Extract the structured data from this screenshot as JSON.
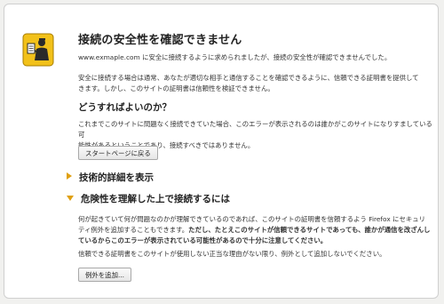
{
  "page": {
    "title": "接続の安全性を確認できません",
    "intro_host": "www.exmaple.com",
    "intro_rest": " に安全に接続するように求められましたが、接続の安全性が確認できませんでした。",
    "paragraph1_line1": "安全に接続する場合は通常、あなたが適切な相手と通信することを確認できるように、信頼できる証明書を提供して",
    "paragraph1_line2": "きます。しかし、このサイトの証明書は信頼性を検証できません。",
    "what_heading": "どうすればよいのか？",
    "paragraph2_line1": "これまでこのサイトに問題なく接続できていた場合、このエラーが表示されるのは誰かがこのサイトになりすましている可",
    "paragraph2_line2": "能性があるということであり、接続すべきではありません。",
    "start_button": "スタートページに戻る",
    "technical_details": "技術的詳細を表示",
    "understand_risks": "危険性を理解した上で接続するには",
    "paragraph3_line1": "何が起きていて何が問題なのかが理解できているのであれば、このサイトの証明書を信頼するよう Firefox にセキュリ",
    "paragraph3_line2_normal": "ティ例外を追加することもできます。",
    "paragraph3_line2_bold": "ただし、たとえこのサイトが信頼できるサイトであっても、誰かが通信を改ざんし",
    "paragraph3_line3_bold": "ているからこのエラーが表示されている可能性があるので十分に注意してください。",
    "paragraph4": "信頼できる証明書をこのサイトが使用しない正当な理由がない限り、例外として追加しないでください。",
    "add_exception_button": "例外を追加..."
  },
  "colors": {
    "accent_arrow": "#e0a010",
    "icon_yellow": "#f2c11a"
  },
  "icons": {
    "main": "security-officer-icon"
  }
}
